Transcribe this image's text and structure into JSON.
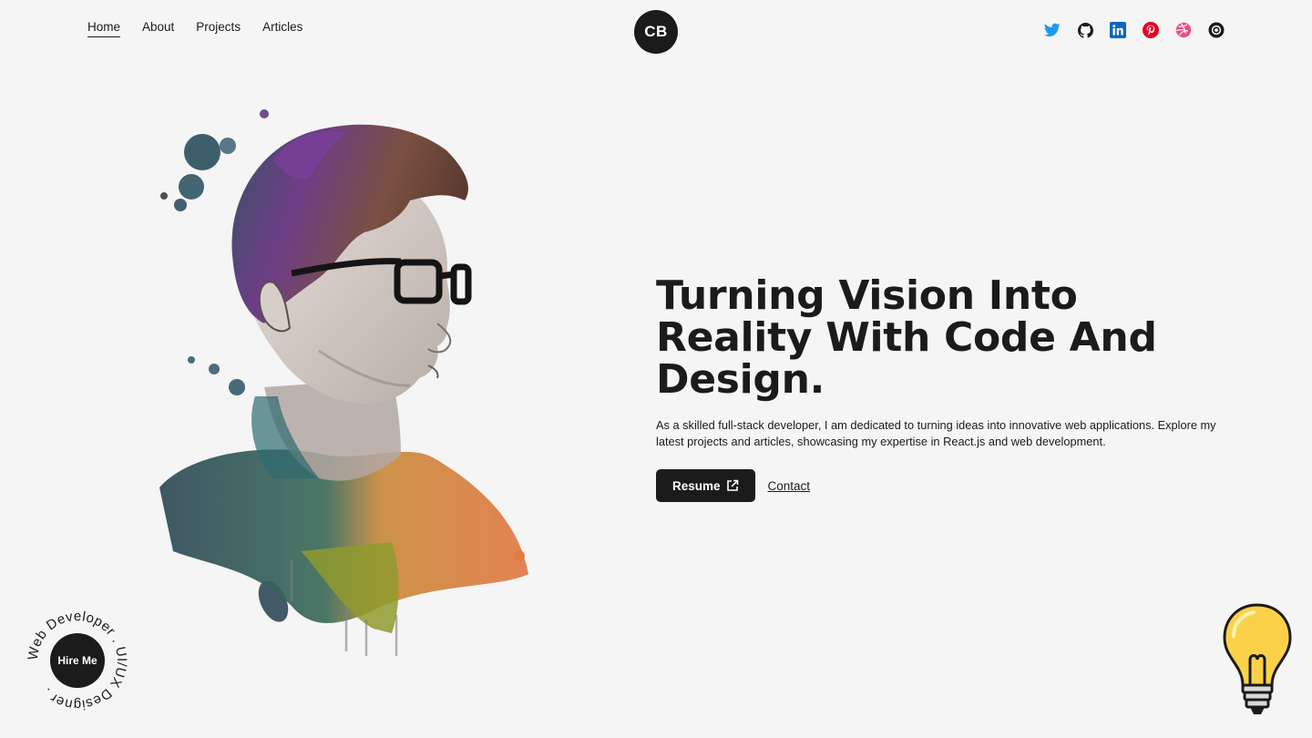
{
  "nav": {
    "items": [
      {
        "label": "Home",
        "active": true
      },
      {
        "label": "About"
      },
      {
        "label": "Projects"
      },
      {
        "label": "Articles"
      }
    ]
  },
  "logo": {
    "text": "CB"
  },
  "social": {
    "icons": [
      "twitter-icon",
      "github-icon",
      "linkedin-icon",
      "pinterest-icon",
      "dribbble-icon",
      "settings-icon"
    ],
    "colors": {
      "twitter": "#1d9bf0",
      "github": "#1b1b1b",
      "linkedin": "#0a66c2",
      "pinterest": "#e60023",
      "dribbble": "#ea4c89"
    }
  },
  "hero": {
    "title_line1": "Turning Vision Into",
    "title_line2": "Reality With Code And",
    "title_line3": "Design.",
    "description": "As a skilled full-stack developer, I am dedicated to turning ideas into innovative web applications. Explore my latest projects and articles, showcasing my expertise in React.js and web development.",
    "resume_label": "Resume",
    "contact_label": "Contact"
  },
  "hire": {
    "label": "Hire Me",
    "ring_text": "Web Developer . UI/UX Designer ."
  },
  "colors": {
    "background": "#f5f5f5",
    "dark": "#1b1b1b"
  }
}
